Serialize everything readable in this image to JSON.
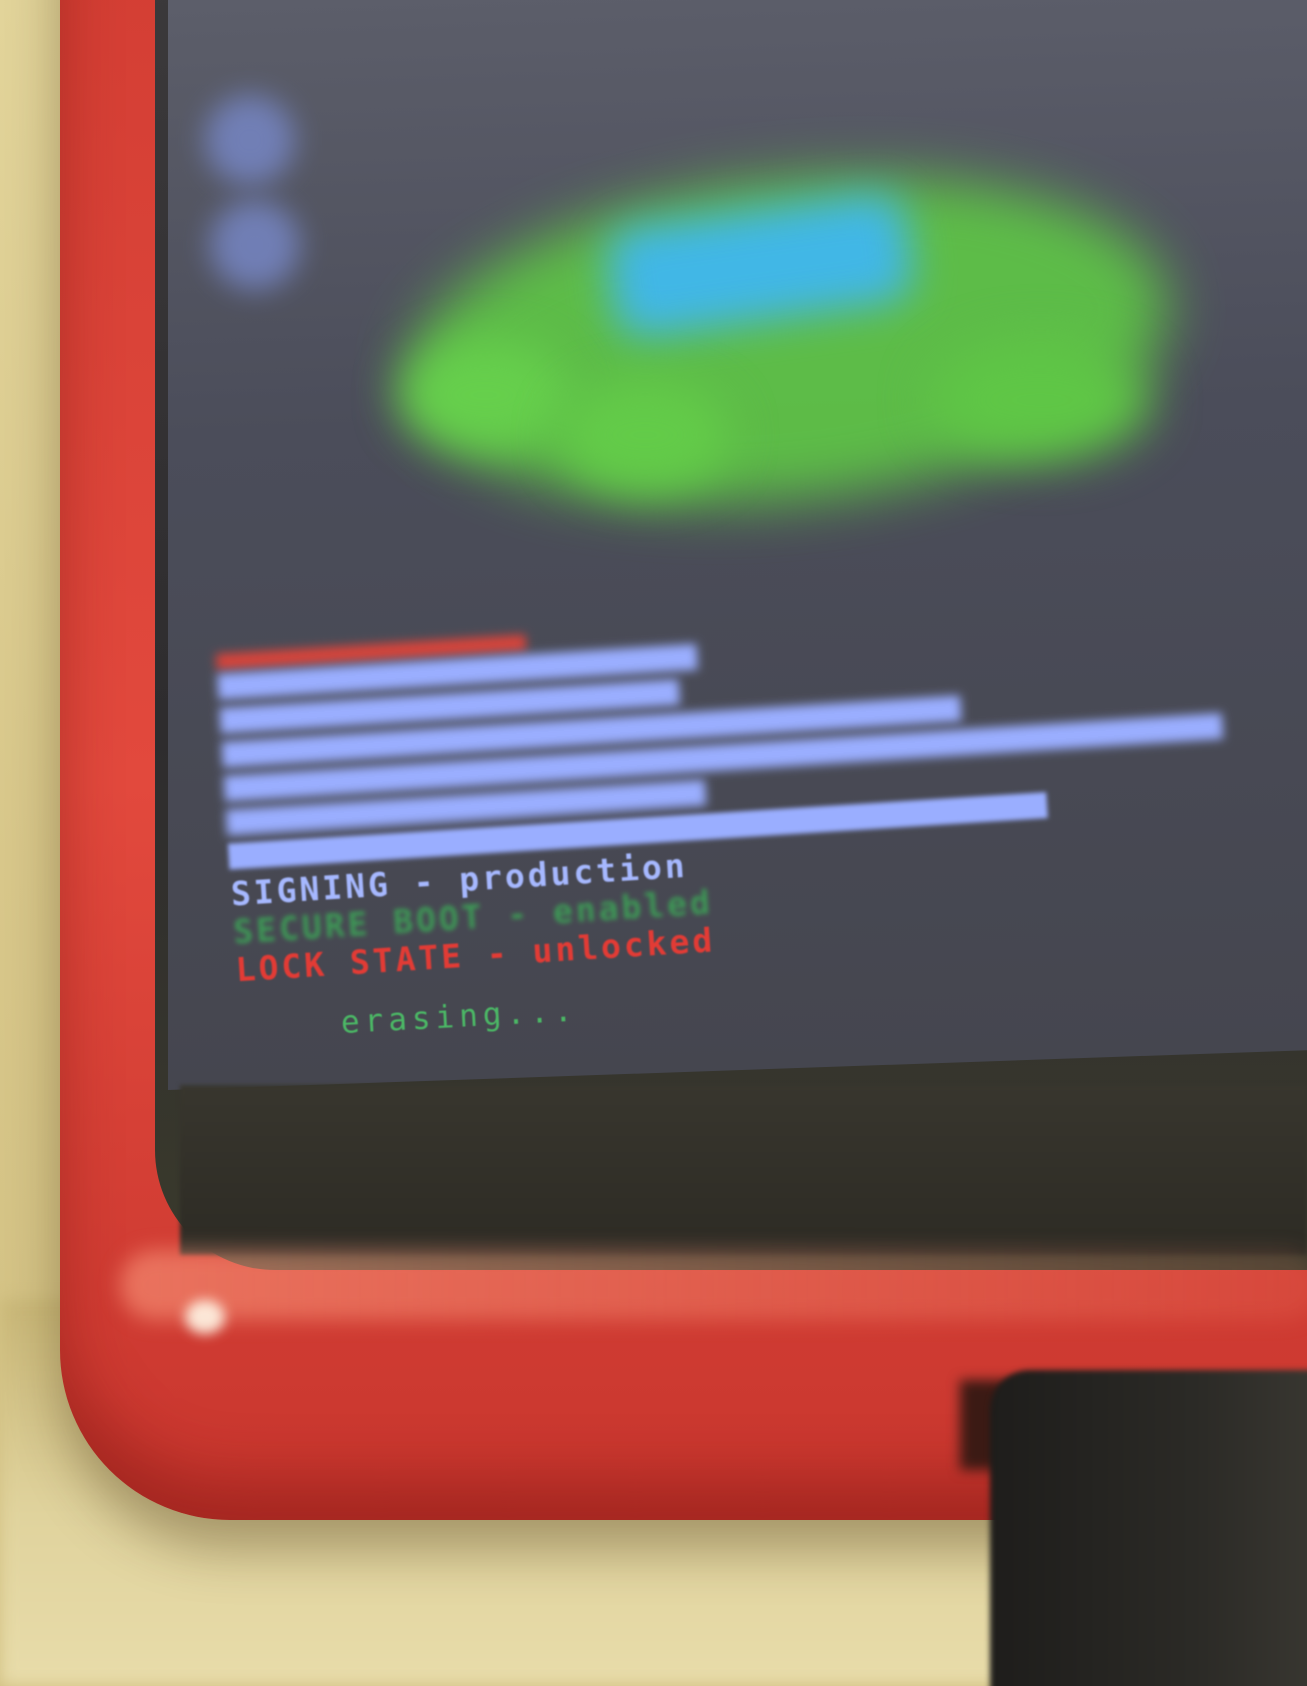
{
  "scene": {
    "description_colors": {
      "bumper": "#d23d33",
      "display": "#4b4d5a",
      "mascot": "#5fc846",
      "mascot_chest": "#41b7e6",
      "table": "#d9c98e"
    }
  },
  "boot_screen": {
    "lines": [
      {
        "text": "SIGNING - production",
        "color": "#a6b8ff"
      },
      {
        "text": "SECURE BOOT - enabled",
        "color": "#3d9a56"
      },
      {
        "text": "LOCK STATE - unlocked",
        "color": "#e23b35"
      }
    ],
    "status": "erasing..."
  }
}
